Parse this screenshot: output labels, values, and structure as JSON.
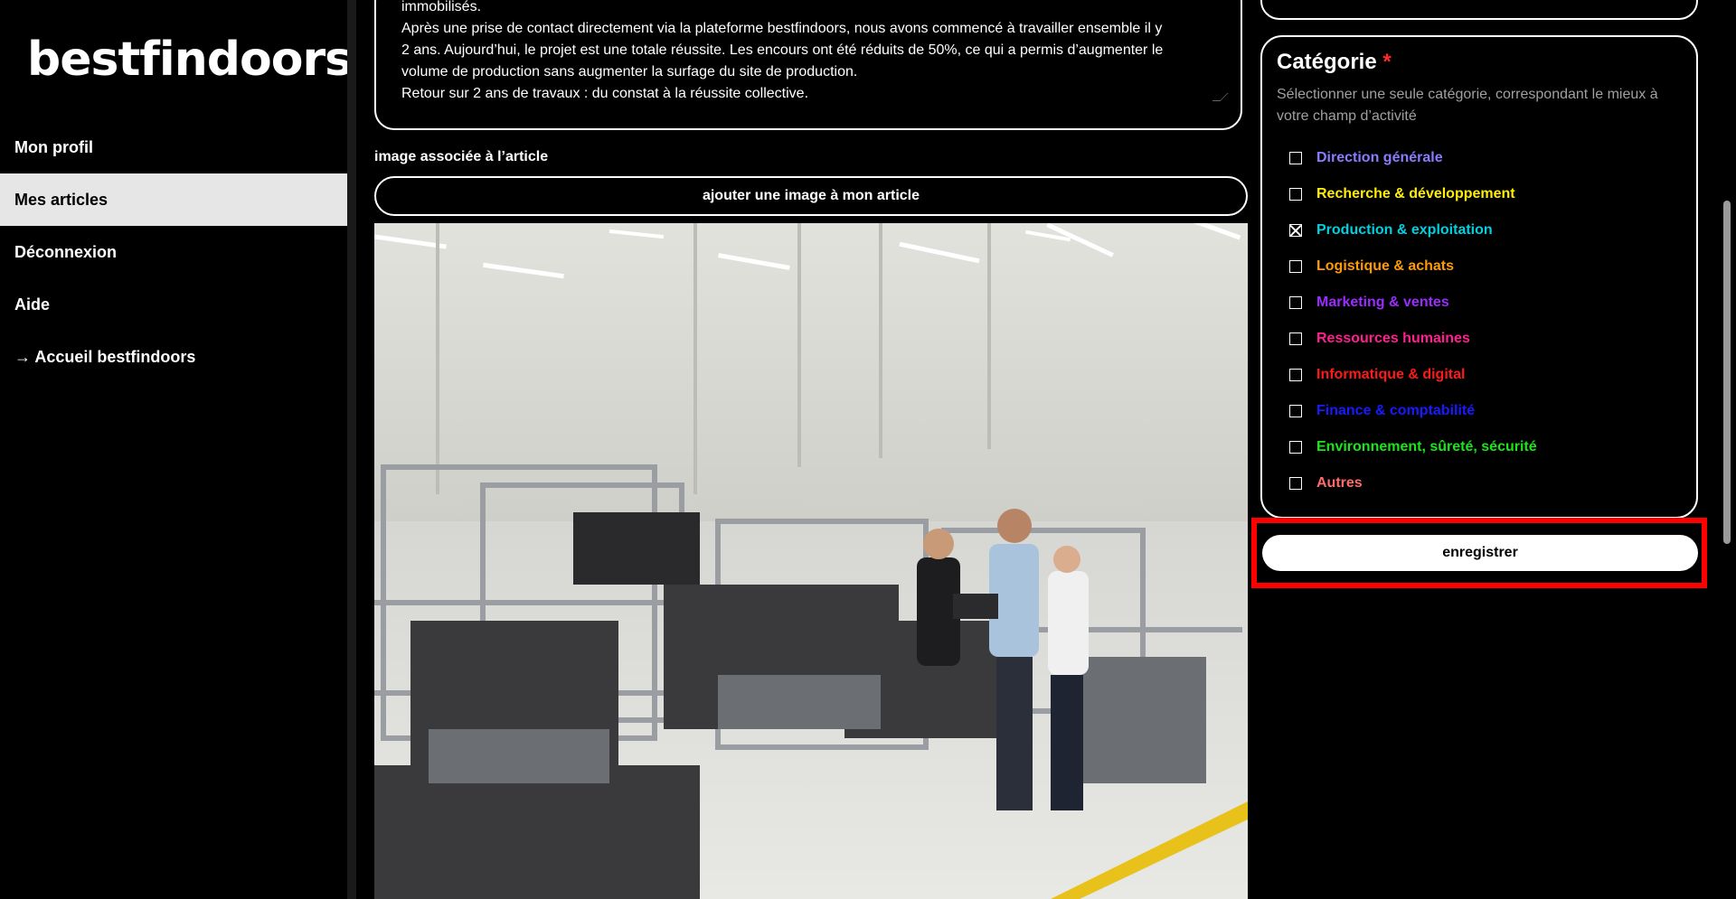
{
  "sidebar": {
    "logo": "bestfindoors",
    "items": [
      {
        "label": "Mon profil"
      },
      {
        "label": "Mes articles"
      },
      {
        "label": "Déconnexion"
      },
      {
        "label": "Aide"
      },
      {
        "label": "→ Accueil bestfindoors"
      }
    ]
  },
  "editor": {
    "text_lines": [
      "immobilisés.",
      "Après une prise de contact directement via la plateforme bestfindoors, nous avons commencé à travailler ensemble il y",
      "2 ans. Aujourd’hui, le projet est une totale réussite. Les encours ont été réduits de 50%, ce qui a permis d’augmenter le",
      "volume de production sans augmenter la surfage du site de production.",
      "Retour sur 2 ans de travaux : du constat à la réussite collective."
    ],
    "image_label": "image associée à l’article",
    "add_image_button": "ajouter une image à mon article"
  },
  "category": {
    "title": "Catégorie",
    "required_mark": "*",
    "help": "Sélectionner une seule catégorie, correspondant le mieux à votre champ d’activité",
    "items": [
      {
        "label": "Direction générale",
        "color": "#8a7cff",
        "checked": false
      },
      {
        "label": "Recherche & développement",
        "color": "#ffee00",
        "checked": false
      },
      {
        "label": "Production & exploitation",
        "color": "#00d0e0",
        "checked": true
      },
      {
        "label": "Logistique & achats",
        "color": "#ff9a00",
        "checked": false
      },
      {
        "label": "Marketing & ventes",
        "color": "#9b2cff",
        "checked": false
      },
      {
        "label": "Ressources humaines",
        "color": "#ff1f8f",
        "checked": false
      },
      {
        "label": "Informatique & digital",
        "color": "#ff1a1a",
        "checked": false
      },
      {
        "label": "Finance & comptabilité",
        "color": "#1a1aff",
        "checked": false
      },
      {
        "label": "Environnement, sûreté, sécurité",
        "color": "#1ae61a",
        "checked": false
      },
      {
        "label": "Autres",
        "color": "#ff6b6b",
        "checked": false
      }
    ]
  },
  "actions": {
    "save_label": "enregistrer"
  }
}
